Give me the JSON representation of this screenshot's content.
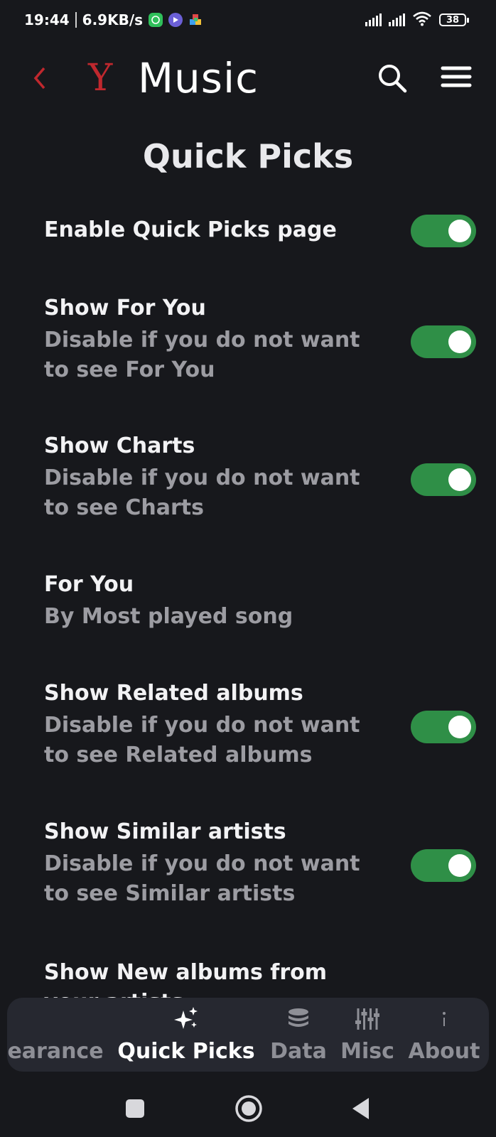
{
  "status_bar": {
    "time": "19:44",
    "speed": "6.9KB/s",
    "battery": "38",
    "notif_icons": [
      "whatsapp-icon",
      "media-player-icon",
      "puzzle-app-icon"
    ],
    "right_icons": [
      "signal-icon",
      "signal-icon",
      "wifi-icon",
      "battery-icon"
    ]
  },
  "header": {
    "logo": "Y",
    "title": "Music",
    "back_icon": "chevron-left-icon",
    "search_icon": "search-icon",
    "menu_icon": "hamburger-menu-icon"
  },
  "page": {
    "title": "Quick Picks"
  },
  "settings": [
    {
      "title": "Enable Quick Picks page",
      "desc": "",
      "toggle": true,
      "on": true
    },
    {
      "title": "Show For You",
      "desc": "Disable if you do not want to see For You",
      "toggle": true,
      "on": true
    },
    {
      "title": "Show Charts",
      "desc": "Disable if you do not want to see Charts",
      "toggle": true,
      "on": true
    },
    {
      "title": "For You",
      "desc": "By Most played song",
      "toggle": false,
      "on": false
    },
    {
      "title": "Show Related albums",
      "desc": "Disable if you do not want to see Related albums",
      "toggle": true,
      "on": true
    },
    {
      "title": "Show Similar artists",
      "desc": "Disable if you do not want to see Similar artists",
      "toggle": true,
      "on": true
    },
    {
      "title": "Show New albums from your artists",
      "desc": "",
      "toggle": true,
      "on": true
    }
  ],
  "tabs": [
    {
      "label": "earance",
      "icon": "",
      "active": false
    },
    {
      "label": "Quick Picks",
      "icon": "sparkles-icon",
      "active": true
    },
    {
      "label": "Data",
      "icon": "database-icon",
      "active": false
    },
    {
      "label": "Misc",
      "icon": "sliders-icon",
      "active": false
    },
    {
      "label": "About",
      "icon": "info-icon",
      "active": false
    }
  ],
  "colors": {
    "background": "#17181c",
    "accent_red": "#c0282e",
    "toggle_on": "#2f8f47",
    "tab_bar": "#262830",
    "secondary_text": "#9c9ca2"
  },
  "nav_bar": {
    "icons": [
      "recents-icon",
      "home-icon",
      "back-icon"
    ]
  }
}
